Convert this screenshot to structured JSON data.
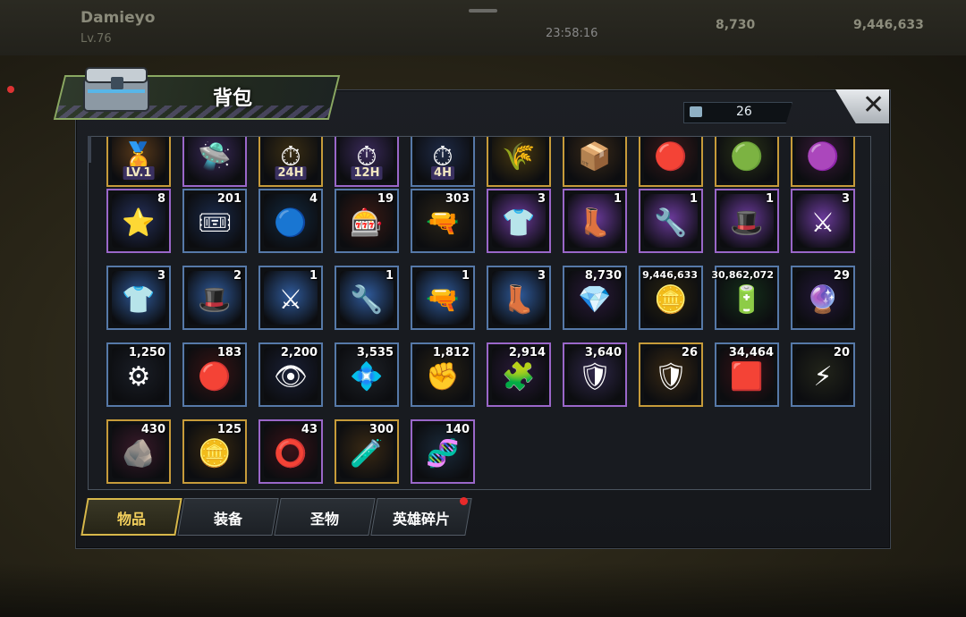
{
  "background": {
    "player_name": "Damieyo",
    "player_level": "Lv.76",
    "timer": "23:58:16",
    "resource_1": "8,730",
    "resource_2": "9,446,633"
  },
  "bag": {
    "title": "背包",
    "capacity": "26",
    "close_label": "✕"
  },
  "tabs": [
    {
      "label": "物品"
    },
    {
      "label": "装备"
    },
    {
      "label": "圣物"
    },
    {
      "label": "英雄碎片"
    }
  ],
  "rows": [
    [
      {
        "name": "badge-lv1",
        "qty": "",
        "icon": "🏅",
        "tag": "LV.1",
        "rarity": "gold",
        "tint": "#5a3a1a"
      },
      {
        "name": "teleport-item",
        "qty": "",
        "icon": "🛸",
        "tag": "",
        "rarity": "purple",
        "tint": "#3a2a5a"
      },
      {
        "name": "speedup-24h",
        "qty": "",
        "icon": "⏱",
        "tag": "24H",
        "rarity": "gold",
        "tint": "#3a2e14"
      },
      {
        "name": "speedup-12h",
        "qty": "",
        "icon": "⏱",
        "tag": "12H",
        "rarity": "purple",
        "tint": "#3a2a5a"
      },
      {
        "name": "speedup-4h",
        "qty": "",
        "icon": "⏱",
        "tag": "4H",
        "rarity": "blue",
        "tint": "#1e2a46"
      },
      {
        "name": "food-token",
        "qty": "",
        "icon": "🌾",
        "tag": "",
        "rarity": "gold",
        "tint": "#4a3a10"
      },
      {
        "name": "crate-item",
        "qty": "",
        "icon": "📦",
        "tag": "",
        "rarity": "gold",
        "tint": "#3a2a18"
      },
      {
        "name": "neon-cap",
        "qty": "",
        "icon": "🔴",
        "tag": "",
        "rarity": "gold",
        "tint": "#3a1a1a"
      },
      {
        "name": "green-cap",
        "qty": "",
        "icon": "🟢",
        "tag": "",
        "rarity": "gold",
        "tint": "#2a3318"
      },
      {
        "name": "pink-cap",
        "qty": "",
        "icon": "🟣",
        "tag": "",
        "rarity": "gold",
        "tint": "#3a1a3a"
      }
    ],
    [
      {
        "name": "police-badge",
        "qty": "8",
        "icon": "⭐",
        "tag": "",
        "rarity": "purple",
        "tint": "#25305a"
      },
      {
        "name": "cinema-ticket",
        "qty": "201",
        "icon": "🎟",
        "tag": "",
        "rarity": "blue",
        "tint": "#1a2a4a"
      },
      {
        "name": "blue-chip",
        "qty": "4",
        "icon": "🔵",
        "tag": "",
        "rarity": "blue",
        "tint": "#12283e"
      },
      {
        "name": "casino-chip",
        "qty": "19",
        "icon": "🎰",
        "tag": "",
        "rarity": "blue",
        "tint": "#3a1a14"
      },
      {
        "name": "bullet",
        "qty": "303",
        "icon": "🔫",
        "tag": "",
        "rarity": "blue",
        "tint": "#2a2418"
      },
      {
        "name": "shirt-blueprint-purple",
        "qty": "3",
        "icon": "👕",
        "tag": "",
        "rarity": "purple",
        "tint": "#6a3a9a"
      },
      {
        "name": "boot-blueprint-purple",
        "qty": "1",
        "icon": "👢",
        "tag": "",
        "rarity": "purple",
        "tint": "#6a3a9a"
      },
      {
        "name": "gun-blueprint-purple",
        "qty": "1",
        "icon": "🔧",
        "tag": "",
        "rarity": "purple",
        "tint": "#6a3a9a"
      },
      {
        "name": "hat-blueprint-purple",
        "qty": "1",
        "icon": "🎩",
        "tag": "",
        "rarity": "purple",
        "tint": "#6a3a9a"
      },
      {
        "name": "sword-blueprint-purple",
        "qty": "3",
        "icon": "⚔",
        "tag": "",
        "rarity": "purple",
        "tint": "#6a3a9a"
      }
    ],
    [
      {
        "name": "shirt-blueprint-blue",
        "qty": "3",
        "icon": "👕",
        "tag": "",
        "rarity": "blue",
        "tint": "#2f5a9a"
      },
      {
        "name": "hat-blueprint-blue",
        "qty": "2",
        "icon": "🎩",
        "tag": "",
        "rarity": "blue",
        "tint": "#2f5a9a"
      },
      {
        "name": "sword-blueprint-blue",
        "qty": "1",
        "icon": "⚔",
        "tag": "",
        "rarity": "blue",
        "tint": "#2f5a9a"
      },
      {
        "name": "gun-blueprint-blue",
        "qty": "1",
        "icon": "🔧",
        "tag": "",
        "rarity": "blue",
        "tint": "#2f5a9a"
      },
      {
        "name": "pistol-blueprint-blue",
        "qty": "1",
        "icon": "🔫",
        "tag": "",
        "rarity": "blue",
        "tint": "#2f5a9a"
      },
      {
        "name": "boot-blueprint-blue",
        "qty": "3",
        "icon": "👢",
        "tag": "",
        "rarity": "blue",
        "tint": "#2f5a9a"
      },
      {
        "name": "purple-gem",
        "qty": "8,730",
        "icon": "💎",
        "tag": "",
        "rarity": "blue",
        "tint": "#2a1a3a"
      },
      {
        "name": "gold-coins",
        "qty": "9,446,633",
        "icon": "🪙",
        "tag": "",
        "rarity": "blue",
        "tint": "#2a2410",
        "small": true
      },
      {
        "name": "green-battery",
        "qty": "30,862,072",
        "icon": "🔋",
        "tag": "",
        "rarity": "blue",
        "tint": "#15301a",
        "small": true
      },
      {
        "name": "purple-orb",
        "qty": "29",
        "icon": "🔮",
        "tag": "",
        "rarity": "blue",
        "tint": "#24183a"
      }
    ],
    [
      {
        "name": "gear-part",
        "qty": "1,250",
        "icon": "⚙",
        "tag": "",
        "rarity": "blue",
        "tint": "#1a1e26"
      },
      {
        "name": "red-token",
        "qty": "183",
        "icon": "🔴",
        "tag": "",
        "rarity": "blue",
        "tint": "#3a1414"
      },
      {
        "name": "red-eye-emblem",
        "qty": "2,200",
        "icon": "👁",
        "tag": "",
        "rarity": "blue",
        "tint": "#1a2036"
      },
      {
        "name": "silver-emblem",
        "qty": "3,535",
        "icon": "💠",
        "tag": "",
        "rarity": "blue",
        "tint": "#1e2228"
      },
      {
        "name": "fist-emblem",
        "qty": "1,812",
        "icon": "✊",
        "tag": "",
        "rarity": "blue",
        "tint": "#2a2416"
      },
      {
        "name": "puzzle-piece",
        "qty": "2,914",
        "icon": "🧩",
        "tag": "",
        "rarity": "purple",
        "tint": "#2a1a3a"
      },
      {
        "name": "hero-shard-purple",
        "qty": "3,640",
        "icon": "🛡",
        "tag": "",
        "rarity": "purple",
        "tint": "#30284a"
      },
      {
        "name": "hero-shard-gold",
        "qty": "26",
        "icon": "🛡",
        "tag": "",
        "rarity": "gold",
        "tint": "#3a2a14"
      },
      {
        "name": "red-crystal",
        "qty": "34,464",
        "icon": "🟥",
        "tag": "",
        "rarity": "blue",
        "tint": "#3a1216"
      },
      {
        "name": "energy-token",
        "qty": "20",
        "icon": "⚡",
        "tag": "",
        "rarity": "blue",
        "tint": "#22241a"
      }
    ],
    [
      {
        "name": "pink-ore",
        "qty": "430",
        "icon": "🪨",
        "tag": "",
        "rarity": "gold",
        "tint": "#3a1a2a"
      },
      {
        "name": "gold-coin-stack",
        "qty": "125",
        "icon": "🪙",
        "tag": "",
        "rarity": "gold",
        "tint": "#3a2a10"
      },
      {
        "name": "red-core",
        "qty": "43",
        "icon": "⭕",
        "tag": "",
        "rarity": "purple",
        "tint": "#3a1218"
      },
      {
        "name": "potion",
        "qty": "300",
        "icon": "🧪",
        "tag": "",
        "rarity": "gold",
        "tint": "#3a2a14"
      },
      {
        "name": "dna-strand",
        "qty": "140",
        "icon": "🧬",
        "tag": "",
        "rarity": "purple",
        "tint": "#1a2a3a"
      }
    ]
  ]
}
